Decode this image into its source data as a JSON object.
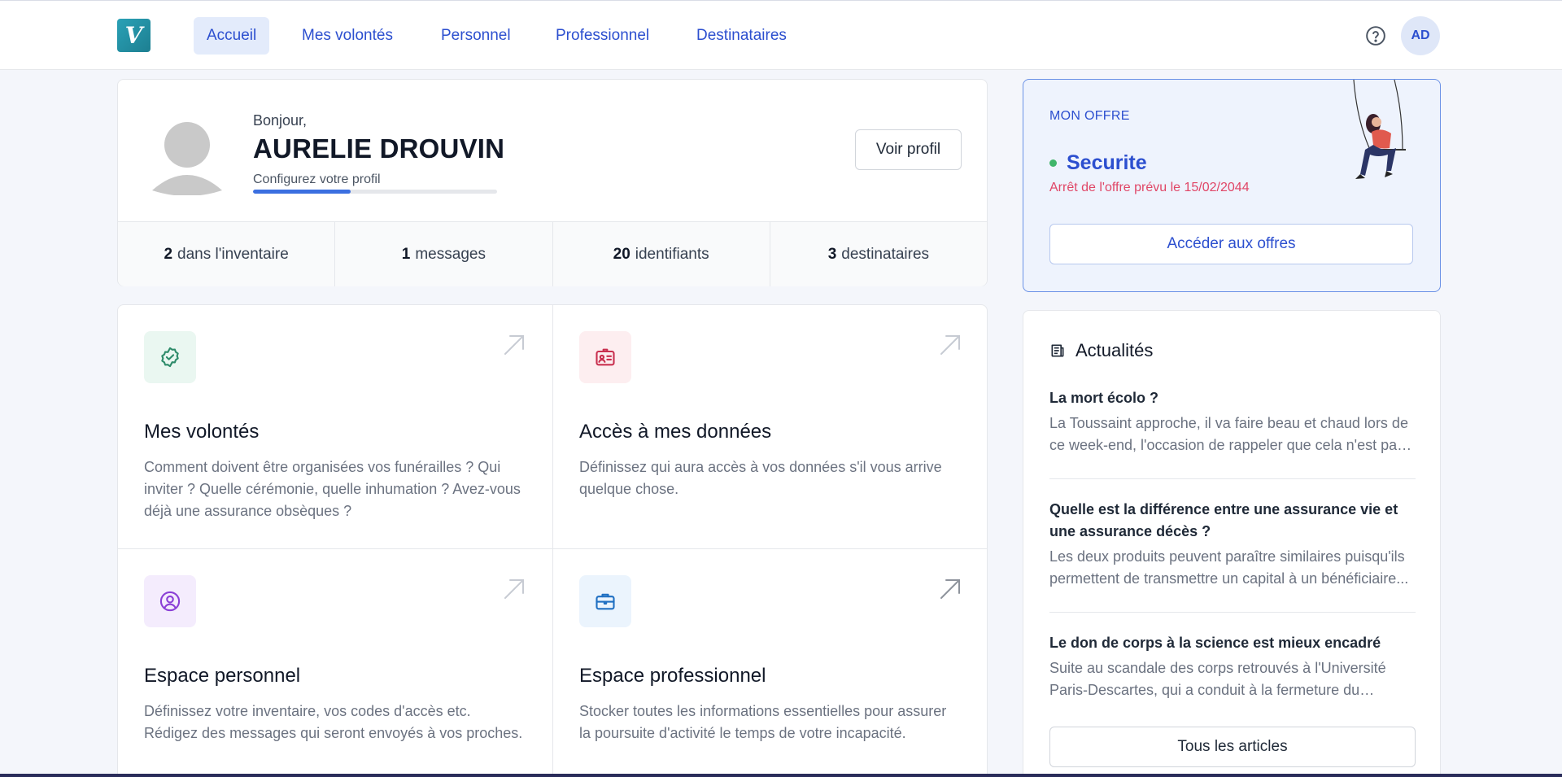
{
  "navbar": {
    "logo_letter": "V",
    "items": [
      {
        "label": "Accueil",
        "active": true
      },
      {
        "label": "Mes volontés"
      },
      {
        "label": "Personnel"
      },
      {
        "label": "Professionnel"
      },
      {
        "label": "Destinataires"
      }
    ],
    "help_icon": "question-circle-icon",
    "user_initials": "AD"
  },
  "profile": {
    "greeting": "Bonjour,",
    "name": "AURELIE DROUVIN",
    "config_label": "Configurez votre profil",
    "progress_percent": 40,
    "view_profile_label": "Voir profil",
    "stats": [
      {
        "count": "2",
        "label": "dans l'inventaire"
      },
      {
        "count": "1",
        "label": "messages"
      },
      {
        "count": "20",
        "label": "identifiants"
      },
      {
        "count": "3",
        "label": "destinataires"
      }
    ]
  },
  "offer": {
    "title": "MON OFFRE",
    "plan_name": "Securite",
    "end_notice": "Arrêt de l'offre prévu le 15/02/2044",
    "cta_label": "Accéder aux offres",
    "status_color": "#3fb56a"
  },
  "tiles": [
    {
      "icon": "badge-check-icon",
      "title": "Mes volontés",
      "description": "Comment doivent être organisées vos funérailles ? Qui inviter ? Quelle cérémonie, quelle inhumation ? Avez-vous déjà une assurance obsèques ?"
    },
    {
      "icon": "id-card-icon",
      "title": "Accès à mes données",
      "description": "Définissez qui aura accès à vos données s'il vous arrive quelque chose."
    },
    {
      "icon": "user-circle-icon",
      "title": "Espace personnel",
      "description": "Définissez votre inventaire, vos codes d'accès etc. Rédigez des messages qui seront envoyés à vos proches."
    },
    {
      "icon": "briefcase-icon",
      "title": "Espace professionnel",
      "description": "Stocker toutes les informations essentielles pour assurer la poursuite d'activité le temps de votre incapacité."
    }
  ],
  "news": {
    "heading": "Actualités",
    "articles": [
      {
        "title": "La mort écolo ?",
        "excerpt": "La Toussaint approche, il va faire beau et chaud lors de ce week-end, l'occasion de rappeler que cela n'est pas anodin..."
      },
      {
        "title": "Quelle est la différence entre une assurance vie et une assurance décès ?",
        "excerpt": "Les deux produits peuvent paraître similaires puisqu'ils permettent de transmettre un capital à un bénéficiaire..."
      },
      {
        "title": "Le don de corps à la science est mieux encadré",
        "excerpt": "Suite au scandale des corps retrouvés à l'Université Paris-Descartes, qui a conduit à la fermeture du centre..."
      }
    ],
    "all_articles_label": "Tous les articles"
  },
  "colors": {
    "accent": "#2c4fcf",
    "alert": "#e04667"
  }
}
